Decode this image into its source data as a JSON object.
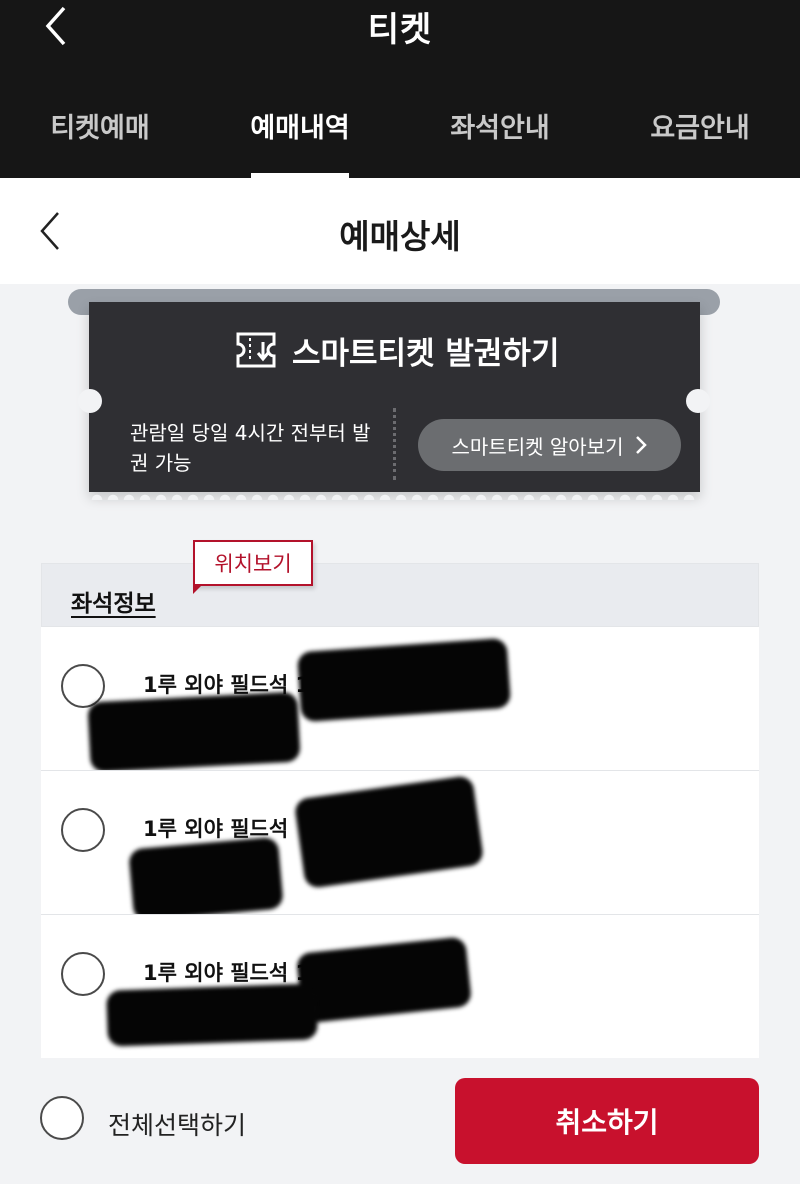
{
  "header": {
    "title": "티켓",
    "back_icon": "chevron-left-icon",
    "tabs": [
      {
        "label": "티켓예매",
        "active": false
      },
      {
        "label": "예매내역",
        "active": true
      },
      {
        "label": "좌석안내",
        "active": false
      },
      {
        "label": "요금안내",
        "active": false
      }
    ]
  },
  "subheader": {
    "title": "예매상세",
    "back_icon": "chevron-left-icon"
  },
  "ticket": {
    "icon": "smart-ticket-icon",
    "title": "스마트티켓 발권하기",
    "note": "관람일 당일 4시간 전부터 발권 가능",
    "learn_more_label": "스마트티켓 알아보기"
  },
  "seat_info": {
    "header_label": "좌석정보",
    "location_tag": "위치보기",
    "rows": [
      {
        "label": "1루 외야 필드석 10",
        "selected": false
      },
      {
        "label": "1루 외야 필드석",
        "selected": false
      },
      {
        "label": "1루 외야 필드석 1",
        "selected": false
      }
    ]
  },
  "footer": {
    "select_all_label": "전체선택하기",
    "cancel_label": "취소하기"
  },
  "colors": {
    "header_bg": "#161616",
    "accent_red": "#c8112d",
    "ticket_bg": "#2f2f33"
  }
}
